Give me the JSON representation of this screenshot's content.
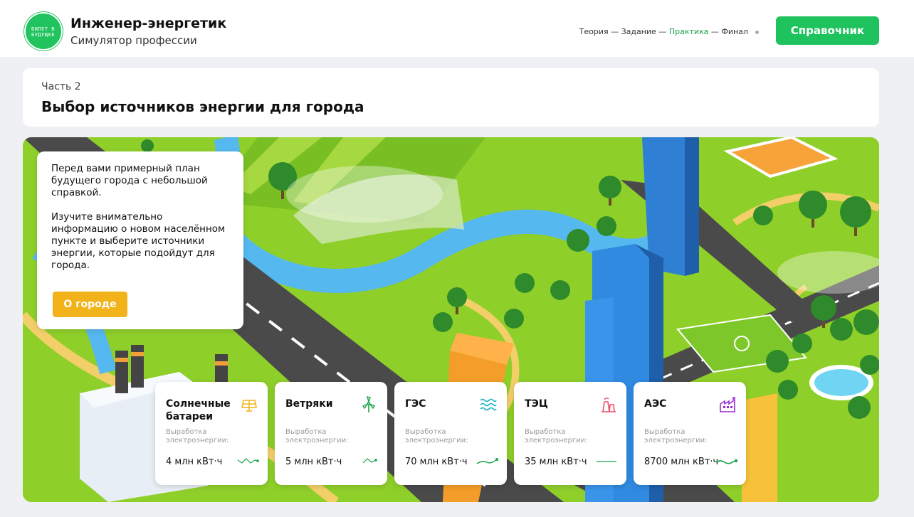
{
  "header": {
    "logo_text_line1": "БИЛЕТ В",
    "logo_text_line2": "БУДУЩЕЕ",
    "title": "Инженер-энергетик",
    "subtitle": "Симулятор профессии",
    "steps": [
      "Теория",
      "Задание",
      "Практика",
      "Финал"
    ],
    "active_step": "Практика",
    "reference_button": "Справочник"
  },
  "section": {
    "part": "Часть 2",
    "title": "Выбор источников энергии для города"
  },
  "info": {
    "paragraph1": "Перед вами примерный план будущего города с небольшой справкой.",
    "paragraph2": "Изучите внимательно информацию о новом населённом пункте и выберите источники энергии, которые подойдут для города.",
    "button": "О городе"
  },
  "sources": [
    {
      "name": "Солнечные батареи",
      "label": "Выработка электроэнергии:",
      "value": "4 млн кВт·ч",
      "icon": "solar-panel-icon",
      "color": "#f2b31a"
    },
    {
      "name": "Ветряки",
      "label": "Выработка электроэнергии:",
      "value": "5 млн кВт·ч",
      "icon": "wind-turbine-icon",
      "color": "#1aa34a"
    },
    {
      "name": "ГЭС",
      "label": "Выработка электроэнергии:",
      "value": "70 млн кВт·ч",
      "icon": "water-waves-icon",
      "color": "#1fb5c9"
    },
    {
      "name": "ТЭЦ",
      "label": "Выработка электроэнергии:",
      "value": "35 млн кВт·ч",
      "icon": "power-plant-icon",
      "color": "#f0506e"
    },
    {
      "name": "АЭС",
      "label": "Выработка электроэнергии:",
      "value": "8700 млн кВт·ч",
      "icon": "factory-icon",
      "color": "#9b2bd6"
    }
  ],
  "colors": {
    "accent_green": "#1ec35e",
    "button_yellow": "#f2b31a",
    "map_grass": "#8fcf2a",
    "river": "#55b8ee"
  }
}
